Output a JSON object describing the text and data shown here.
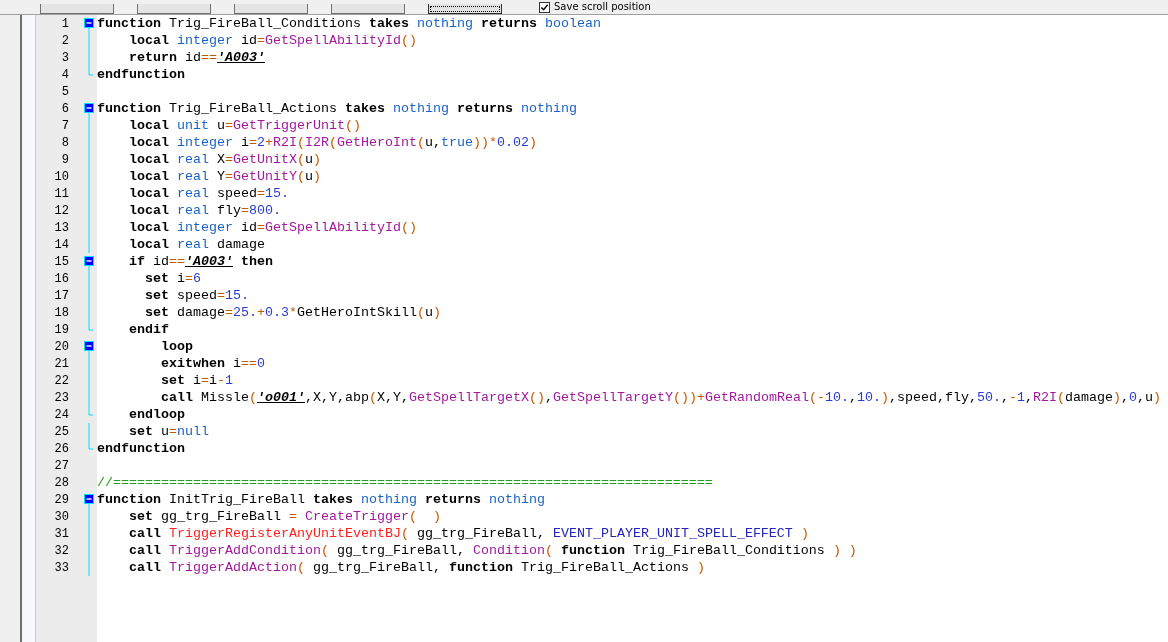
{
  "toolbar": {
    "buttons": [
      {
        "focused": false
      },
      {
        "focused": false
      },
      {
        "focused": false
      },
      {
        "focused": false
      },
      {
        "focused": true
      }
    ],
    "save_scroll": {
      "label": "Save scroll position",
      "checked": true
    }
  },
  "lines": [
    {
      "number": "1",
      "kind": "start",
      "tokens": [
        {
          "kind": "kw",
          "text": "function "
        },
        {
          "kind": "id",
          "text": "Trig_FireBall_Conditions "
        },
        {
          "kind": "kw",
          "text": "takes "
        },
        {
          "kind": "type",
          "text": "nothing "
        },
        {
          "kind": "kw",
          "text": "returns "
        },
        {
          "kind": "type",
          "text": "boolean"
        }
      ]
    },
    {
      "number": "2",
      "kind": "inner",
      "tokens": [
        {
          "kind": "kw",
          "text": "    local "
        },
        {
          "kind": "type",
          "text": "integer "
        },
        {
          "kind": "id",
          "text": "id"
        },
        {
          "kind": "op",
          "text": "="
        },
        {
          "kind": "fn",
          "text": "GetSpellAbilityId"
        },
        {
          "kind": "op",
          "text": "()"
        }
      ]
    },
    {
      "number": "3",
      "kind": "inner",
      "tokens": [
        {
          "kind": "kw",
          "text": "    return "
        },
        {
          "kind": "id",
          "text": "id"
        },
        {
          "kind": "op",
          "text": "=="
        },
        {
          "kind": "str",
          "text": "'A003'"
        }
      ]
    },
    {
      "number": "4",
      "kind": "end",
      "tokens": [
        {
          "kind": "kw",
          "text": "endfunction"
        }
      ]
    },
    {
      "number": "5",
      "kind": "plain"
    },
    {
      "number": "6",
      "kind": "start",
      "tokens": [
        {
          "kind": "kw",
          "text": "function "
        },
        {
          "kind": "id",
          "text": "Trig_FireBall_Actions "
        },
        {
          "kind": "kw",
          "text": "takes "
        },
        {
          "kind": "type",
          "text": "nothing "
        },
        {
          "kind": "kw",
          "text": "returns "
        },
        {
          "kind": "type",
          "text": "nothing"
        }
      ]
    },
    {
      "number": "7",
      "kind": "inner",
      "tokens": [
        {
          "kind": "kw",
          "text": "    local "
        },
        {
          "kind": "type",
          "text": "unit "
        },
        {
          "kind": "id",
          "text": "u"
        },
        {
          "kind": "op",
          "text": "="
        },
        {
          "kind": "fn",
          "text": "GetTriggerUnit"
        },
        {
          "kind": "op",
          "text": "()"
        }
      ]
    },
    {
      "number": "8",
      "kind": "inner",
      "tokens": [
        {
          "kind": "kw",
          "text": "    local "
        },
        {
          "kind": "type",
          "text": "integer "
        },
        {
          "kind": "id",
          "text": "i"
        },
        {
          "kind": "op",
          "text": "="
        },
        {
          "kind": "num",
          "text": "2"
        },
        {
          "kind": "op",
          "text": "+"
        },
        {
          "kind": "fn",
          "text": "R2I"
        },
        {
          "kind": "op",
          "text": "("
        },
        {
          "kind": "fn",
          "text": "I2R"
        },
        {
          "kind": "op",
          "text": "("
        },
        {
          "kind": "fn",
          "text": "GetHeroInt"
        },
        {
          "kind": "op",
          "text": "("
        },
        {
          "kind": "id",
          "text": "u,"
        },
        {
          "kind": "type",
          "text": "true"
        },
        {
          "kind": "op",
          "text": "))*"
        },
        {
          "kind": "num",
          "text": "0.02"
        },
        {
          "kind": "op",
          "text": ")"
        }
      ]
    },
    {
      "number": "9",
      "kind": "inner",
      "tokens": [
        {
          "kind": "kw",
          "text": "    local "
        },
        {
          "kind": "type",
          "text": "real "
        },
        {
          "kind": "id",
          "text": "X"
        },
        {
          "kind": "op",
          "text": "="
        },
        {
          "kind": "fn",
          "text": "GetUnitX"
        },
        {
          "kind": "op",
          "text": "("
        },
        {
          "kind": "id",
          "text": "u"
        },
        {
          "kind": "op",
          "text": ")"
        }
      ]
    },
    {
      "number": "10",
      "kind": "inner",
      "tokens": [
        {
          "kind": "kw",
          "text": "    local "
        },
        {
          "kind": "type",
          "text": "real "
        },
        {
          "kind": "id",
          "text": "Y"
        },
        {
          "kind": "op",
          "text": "="
        },
        {
          "kind": "fn",
          "text": "GetUnitY"
        },
        {
          "kind": "op",
          "text": "("
        },
        {
          "kind": "id",
          "text": "u"
        },
        {
          "kind": "op",
          "text": ")"
        }
      ]
    },
    {
      "number": "11",
      "kind": "inner",
      "tokens": [
        {
          "kind": "kw",
          "text": "    local "
        },
        {
          "kind": "type",
          "text": "real "
        },
        {
          "kind": "id",
          "text": "speed"
        },
        {
          "kind": "op",
          "text": "="
        },
        {
          "kind": "num",
          "text": "15."
        }
      ]
    },
    {
      "number": "12",
      "kind": "inner",
      "tokens": [
        {
          "kind": "kw",
          "text": "    local "
        },
        {
          "kind": "type",
          "text": "real "
        },
        {
          "kind": "id",
          "text": "fly"
        },
        {
          "kind": "op",
          "text": "="
        },
        {
          "kind": "num",
          "text": "800."
        }
      ]
    },
    {
      "number": "13",
      "kind": "inner",
      "tokens": [
        {
          "kind": "kw",
          "text": "    local "
        },
        {
          "kind": "type",
          "text": "integer "
        },
        {
          "kind": "id",
          "text": "id"
        },
        {
          "kind": "op",
          "text": "="
        },
        {
          "kind": "fn",
          "text": "GetSpellAbilityId"
        },
        {
          "kind": "op",
          "text": "()"
        }
      ]
    },
    {
      "number": "14",
      "kind": "inner",
      "tokens": [
        {
          "kind": "kw",
          "text": "    local "
        },
        {
          "kind": "type",
          "text": "real "
        },
        {
          "kind": "id",
          "text": "damage"
        }
      ]
    },
    {
      "number": "15",
      "kind": "start",
      "tokens": [
        {
          "kind": "kw",
          "text": "    if "
        },
        {
          "kind": "id",
          "text": "id"
        },
        {
          "kind": "op",
          "text": "=="
        },
        {
          "kind": "str",
          "text": "'A003'"
        },
        {
          "kind": "kw",
          "text": " then"
        }
      ]
    },
    {
      "number": "16",
      "kind": "inner",
      "tokens": [
        {
          "kind": "kw",
          "text": "      set "
        },
        {
          "kind": "id",
          "text": "i"
        },
        {
          "kind": "op",
          "text": "="
        },
        {
          "kind": "num",
          "text": "6"
        }
      ]
    },
    {
      "number": "17",
      "kind": "inner",
      "tokens": [
        {
          "kind": "kw",
          "text": "      set "
        },
        {
          "kind": "id",
          "text": "speed"
        },
        {
          "kind": "op",
          "text": "="
        },
        {
          "kind": "num",
          "text": "15."
        }
      ]
    },
    {
      "number": "18",
      "kind": "inner",
      "tokens": [
        {
          "kind": "kw",
          "text": "      set "
        },
        {
          "kind": "id",
          "text": "damage"
        },
        {
          "kind": "op",
          "text": "="
        },
        {
          "kind": "num",
          "text": "25."
        },
        {
          "kind": "op",
          "text": "+"
        },
        {
          "kind": "num",
          "text": "0.3"
        },
        {
          "kind": "op",
          "text": "*"
        },
        {
          "kind": "id",
          "text": "GetHeroIntSkill"
        },
        {
          "kind": "op",
          "text": "("
        },
        {
          "kind": "id",
          "text": "u"
        },
        {
          "kind": "op",
          "text": ")"
        }
      ]
    },
    {
      "number": "19",
      "kind": "end",
      "tokens": [
        {
          "kind": "kw",
          "text": "    endif"
        }
      ]
    },
    {
      "number": "20",
      "kind": "start",
      "tokens": [
        {
          "kind": "kw",
          "text": "        loop"
        }
      ]
    },
    {
      "number": "21",
      "kind": "inner",
      "tokens": [
        {
          "kind": "kw",
          "text": "        exitwhen "
        },
        {
          "kind": "id",
          "text": "i"
        },
        {
          "kind": "op",
          "text": "=="
        },
        {
          "kind": "num",
          "text": "0"
        }
      ]
    },
    {
      "number": "22",
      "kind": "inner",
      "tokens": [
        {
          "kind": "kw",
          "text": "        set "
        },
        {
          "kind": "id",
          "text": "i"
        },
        {
          "kind": "op",
          "text": "="
        },
        {
          "kind": "id",
          "text": "i"
        },
        {
          "kind": "op",
          "text": "-"
        },
        {
          "kind": "num",
          "text": "1"
        }
      ]
    },
    {
      "number": "23",
      "kind": "inner",
      "tokens": [
        {
          "kind": "kw",
          "text": "        call "
        },
        {
          "kind": "id",
          "text": "Missle"
        },
        {
          "kind": "op",
          "text": "("
        },
        {
          "kind": "str",
          "text": "'o001'"
        },
        {
          "kind": "id",
          "text": ",X,Y,abp"
        },
        {
          "kind": "op",
          "text": "("
        },
        {
          "kind": "id",
          "text": "X,Y,"
        },
        {
          "kind": "fn",
          "text": "GetSpellTargetX"
        },
        {
          "kind": "op",
          "text": "()"
        },
        {
          "kind": "id",
          "text": ","
        },
        {
          "kind": "fn",
          "text": "GetSpellTargetY"
        },
        {
          "kind": "op",
          "text": "())+"
        },
        {
          "kind": "fn",
          "text": "GetRandomReal"
        },
        {
          "kind": "op",
          "text": "(-"
        },
        {
          "kind": "num",
          "text": "10."
        },
        {
          "kind": "id",
          "text": ","
        },
        {
          "kind": "num",
          "text": "10."
        },
        {
          "kind": "op",
          "text": ")"
        },
        {
          "kind": "id",
          "text": ",speed,fly,"
        },
        {
          "kind": "num",
          "text": "50."
        },
        {
          "kind": "id",
          "text": ","
        },
        {
          "kind": "op",
          "text": "-"
        },
        {
          "kind": "num",
          "text": "1"
        },
        {
          "kind": "id",
          "text": ","
        },
        {
          "kind": "fn",
          "text": "R2I"
        },
        {
          "kind": "op",
          "text": "("
        },
        {
          "kind": "id",
          "text": "damage"
        },
        {
          "kind": "op",
          "text": ")"
        },
        {
          "kind": "id",
          "text": ","
        },
        {
          "kind": "num",
          "text": "0"
        },
        {
          "kind": "id",
          "text": ",u"
        },
        {
          "kind": "op",
          "text": ")"
        }
      ]
    },
    {
      "number": "24",
      "kind": "end",
      "tokens": [
        {
          "kind": "kw",
          "text": "    endloop"
        }
      ]
    },
    {
      "number": "25",
      "kind": "inner",
      "tokens": [
        {
          "kind": "kw",
          "text": "    set "
        },
        {
          "kind": "id",
          "text": "u"
        },
        {
          "kind": "op",
          "text": "="
        },
        {
          "kind": "type",
          "text": "null"
        }
      ]
    },
    {
      "number": "26",
      "kind": "end",
      "tokens": [
        {
          "kind": "kw",
          "text": "endfunction"
        }
      ]
    },
    {
      "number": "27",
      "kind": "plain"
    },
    {
      "number": "28",
      "kind": "plain",
      "tokens": [
        {
          "kind": "cmt",
          "text": "//==========================================================================="
        }
      ]
    },
    {
      "number": "29",
      "kind": "start",
      "tokens": [
        {
          "kind": "kw",
          "text": "function "
        },
        {
          "kind": "id",
          "text": "InitTrig_FireBall "
        },
        {
          "kind": "kw",
          "text": "takes "
        },
        {
          "kind": "type",
          "text": "nothing "
        },
        {
          "kind": "kw",
          "text": "returns "
        },
        {
          "kind": "type",
          "text": "nothing"
        }
      ]
    },
    {
      "number": "30",
      "kind": "inner",
      "tokens": [
        {
          "kind": "kw",
          "text": "    set "
        },
        {
          "kind": "id",
          "text": "gg_trg_FireBall "
        },
        {
          "kind": "op",
          "text": "= "
        },
        {
          "kind": "fn",
          "text": "CreateTrigger"
        },
        {
          "kind": "op",
          "text": "(  )"
        }
      ]
    },
    {
      "number": "31",
      "kind": "inner",
      "tokens": [
        {
          "kind": "kw",
          "text": "    call "
        },
        {
          "kind": "bj",
          "text": "TriggerRegisterAnyUnitEventBJ"
        },
        {
          "kind": "op",
          "text": "( "
        },
        {
          "kind": "id",
          "text": "gg_trg_FireBall, "
        },
        {
          "kind": "const",
          "text": "EVENT_PLAYER_UNIT_SPELL_EFFECT "
        },
        {
          "kind": "op",
          "text": ")"
        }
      ]
    },
    {
      "number": "32",
      "kind": "inner",
      "tokens": [
        {
          "kind": "kw",
          "text": "    call "
        },
        {
          "kind": "fn",
          "text": "TriggerAddCondition"
        },
        {
          "kind": "op",
          "text": "( "
        },
        {
          "kind": "id",
          "text": "gg_trg_FireBall, "
        },
        {
          "kind": "fn",
          "text": "Condition"
        },
        {
          "kind": "op",
          "text": "( "
        },
        {
          "kind": "kw",
          "text": "function "
        },
        {
          "kind": "id",
          "text": "Trig_FireBall_Conditions "
        },
        {
          "kind": "op",
          "text": ") )"
        }
      ]
    },
    {
      "number": "33",
      "kind": "inner",
      "tokens": [
        {
          "kind": "kw",
          "text": "    call "
        },
        {
          "kind": "fn",
          "text": "TriggerAddAction"
        },
        {
          "kind": "op",
          "text": "( "
        },
        {
          "kind": "id",
          "text": "gg_trg_FireBall, "
        },
        {
          "kind": "kw",
          "text": "function "
        },
        {
          "kind": "id",
          "text": "Trig_FireBall_Actions "
        },
        {
          "kind": "op",
          "text": ")"
        }
      ]
    }
  ]
}
